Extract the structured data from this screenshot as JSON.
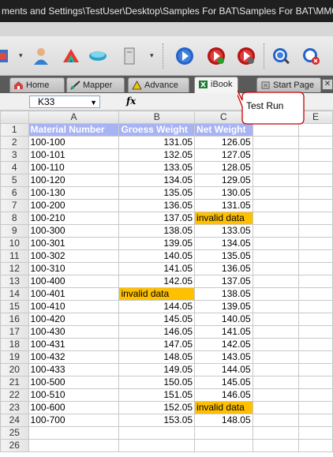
{
  "window": {
    "title": "ments and Settings\\TestUser\\Desktop\\Samples For BAT\\Samples For BAT\\MM0"
  },
  "tabs": [
    {
      "label": "Home"
    },
    {
      "label": "Mapper"
    },
    {
      "label": "Advance"
    },
    {
      "label": "iBook"
    },
    {
      "label": "Start Page"
    }
  ],
  "formula_bar": {
    "cell_ref": "K33",
    "fx": "fx"
  },
  "callout": {
    "text": "Test Run"
  },
  "columns": [
    "A",
    "B",
    "C",
    "E"
  ],
  "header_row": {
    "row": "1",
    "a": "Material Number",
    "b": "Groess Weight",
    "c": "Net Weight"
  },
  "rows": [
    {
      "row": "2",
      "a": "100-100",
      "b": "131.05",
      "c": "126.05"
    },
    {
      "row": "3",
      "a": "100-101",
      "b": "132.05",
      "c": "127.05"
    },
    {
      "row": "4",
      "a": "100-110",
      "b": "133.05",
      "c": "128.05"
    },
    {
      "row": "5",
      "a": "100-120",
      "b": "134.05",
      "c": "129.05"
    },
    {
      "row": "6",
      "a": "100-130",
      "b": "135.05",
      "c": "130.05"
    },
    {
      "row": "7",
      "a": "100-200",
      "b": "136.05",
      "c": "131.05"
    },
    {
      "row": "8",
      "a": "100-210",
      "b": "137.05",
      "c": "invalid data"
    },
    {
      "row": "9",
      "a": "100-300",
      "b": "138.05",
      "c": "133.05"
    },
    {
      "row": "10",
      "a": "100-301",
      "b": "139.05",
      "c": "134.05"
    },
    {
      "row": "11",
      "a": "100-302",
      "b": "140.05",
      "c": "135.05"
    },
    {
      "row": "12",
      "a": "100-310",
      "b": "141.05",
      "c": "136.05"
    },
    {
      "row": "13",
      "a": "100-400",
      "b": "142.05",
      "c": "137.05"
    },
    {
      "row": "14",
      "a": "100-401",
      "b": "invalid data",
      "c": "138.05"
    },
    {
      "row": "15",
      "a": "100-410",
      "b": "144.05",
      "c": "139.05"
    },
    {
      "row": "16",
      "a": "100-420",
      "b": "145.05",
      "c": "140.05"
    },
    {
      "row": "17",
      "a": "100-430",
      "b": "146.05",
      "c": "141.05"
    },
    {
      "row": "18",
      "a": "100-431",
      "b": "147.05",
      "c": "142.05"
    },
    {
      "row": "19",
      "a": "100-432",
      "b": "148.05",
      "c": "143.05"
    },
    {
      "row": "20",
      "a": "100-433",
      "b": "149.05",
      "c": "144.05"
    },
    {
      "row": "21",
      "a": "100-500",
      "b": "150.05",
      "c": "145.05"
    },
    {
      "row": "22",
      "a": "100-510",
      "b": "151.05",
      "c": "146.05"
    },
    {
      "row": "23",
      "a": "100-600",
      "b": "152.05",
      "c": "invalid data"
    },
    {
      "row": "24",
      "a": "100-700",
      "b": "153.05",
      "c": "148.05"
    },
    {
      "row": "25",
      "a": "",
      "b": "",
      "c": ""
    },
    {
      "row": "26",
      "a": "",
      "b": "",
      "c": ""
    }
  ],
  "colors": {
    "header_bg": "#a7b3f3",
    "invalid_bg": "#ffc000",
    "callout_border": "#cc0000"
  }
}
